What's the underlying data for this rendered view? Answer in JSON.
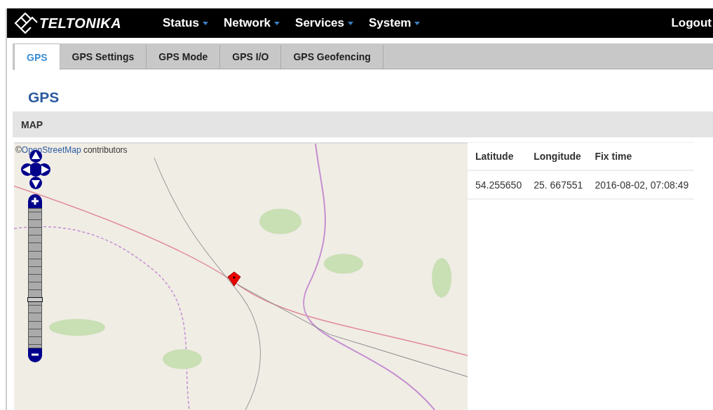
{
  "header": {
    "logo": "TELTONIKA",
    "menu": [
      {
        "label": "Status"
      },
      {
        "label": "Network"
      },
      {
        "label": "Services"
      },
      {
        "label": "System"
      }
    ],
    "logout": "Logout"
  },
  "tabs": [
    {
      "label": "GPS",
      "selected": true
    },
    {
      "label": "GPS Settings",
      "selected": false
    },
    {
      "label": "GPS Mode",
      "selected": false
    },
    {
      "label": "GPS I/O",
      "selected": false
    },
    {
      "label": "GPS Geofencing",
      "selected": false
    }
  ],
  "page_title": "GPS",
  "section": {
    "title": "MAP"
  },
  "map": {
    "attribution_symbol": "©",
    "attribution_link": "OpenStreetMap",
    "attribution_text": "contributors",
    "zoom": {
      "level": 0.33
    }
  },
  "table": {
    "columns": [
      "Latitude",
      "Longitude",
      "Fix time"
    ],
    "rows": [
      [
        "54.255650",
        "25. 667551",
        "2016-08-02, 07:08:49"
      ]
    ]
  }
}
